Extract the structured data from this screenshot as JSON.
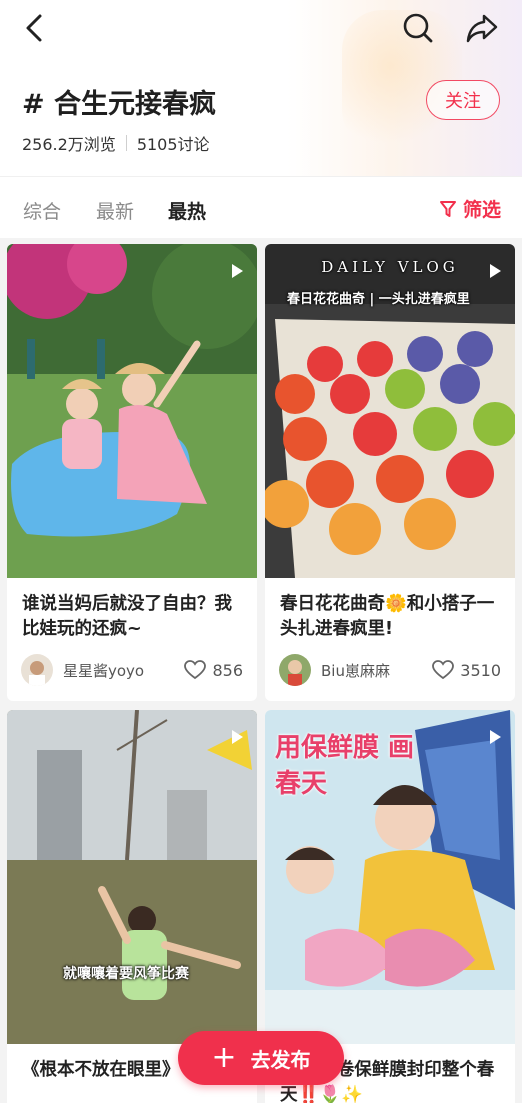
{
  "header": {
    "topic_title": "# 合生元接春疯",
    "follow_label": "关注",
    "views": "256.2万浏览",
    "discussions": "5105讨论"
  },
  "tabs": [
    {
      "label": "综合",
      "active": false
    },
    {
      "label": "最新",
      "active": false
    },
    {
      "label": "最热",
      "active": true
    }
  ],
  "filter_label": "筛选",
  "accent_color": "#f2304c",
  "cards": [
    {
      "title": "谁说当妈后就没了自由？我比娃玩的还疯~",
      "author": "星星酱yoyo",
      "likes": "856",
      "is_video": true
    },
    {
      "title": "春日花花曲奇🌼和小搭子一头扎进春疯里!",
      "author": "Biu崽麻麻",
      "likes": "3510",
      "is_video": true,
      "overlay_top": "DAILY VLOG",
      "overlay_caption": "春日花花曲奇 | 一头扎进春疯里"
    },
    {
      "title": "《根本不放在眼里》",
      "is_video": true,
      "overlay_caption": "就嚷嚷着要风筝比赛"
    },
    {
      "title": "玩🦋一卷保鲜膜封印整个春天‼️🌷✨",
      "is_video": true,
      "overlay_caption": "用保鲜膜 画春天"
    }
  ],
  "publish_label": "去发布"
}
